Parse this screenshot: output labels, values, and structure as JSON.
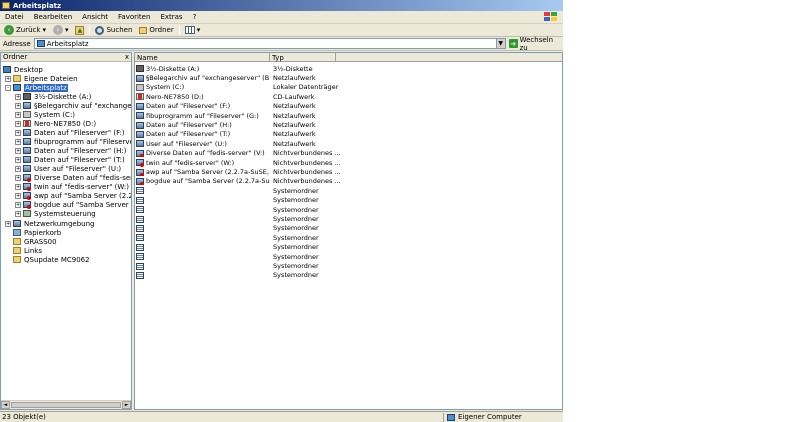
{
  "window": {
    "title": "Arbeitsplatz"
  },
  "menu": [
    "Datei",
    "Bearbeiten",
    "Ansicht",
    "Favoriten",
    "Extras",
    "?"
  ],
  "toolbar": {
    "back": "Zurück",
    "search": "Suchen",
    "folders": "Ordner"
  },
  "address": {
    "label": "Adresse",
    "value": "Arbeitsplatz",
    "go": "Wechseln zu"
  },
  "folder_pane": {
    "header": "Ordner",
    "close": "x",
    "tree": [
      {
        "label": "Desktop",
        "icon": "desktop-icon"
      },
      {
        "label": "Eigene Dateien",
        "icon": "folder-icon"
      },
      {
        "label": "Arbeitsplatz",
        "icon": "computer-icon",
        "selected": true
      },
      {
        "label": "3½-Diskette (A:)",
        "icon": "floppy-icon"
      },
      {
        "label": "§Belegarchiv auf \"exchangeserver\" (B:)",
        "icon": "network-drive-icon"
      },
      {
        "label": "System (C:)",
        "icon": "drive-icon"
      },
      {
        "label": "Nero-NE7850 (D:)",
        "icon": "cd-drive-icon"
      },
      {
        "label": "Daten auf \"Fileserver\" (F:)",
        "icon": "network-drive-icon"
      },
      {
        "label": "fibuprogramm auf \"Fileserver\" (G:)",
        "icon": "network-drive-icon"
      },
      {
        "label": "Daten auf \"Fileserver\" (H:)",
        "icon": "network-drive-icon"
      },
      {
        "label": "Daten auf \"Fileserver\" (T:)",
        "icon": "network-drive-icon"
      },
      {
        "label": "User auf \"Fileserver\" (U:)",
        "icon": "network-drive-icon"
      },
      {
        "label": "Diverse Daten auf \"fedis-server\" (V:)",
        "icon": "disconnected-drive-icon"
      },
      {
        "label": "twin auf \"fedis-server\" (W:)",
        "icon": "disconnected-drive-icon"
      },
      {
        "label": "awp auf \"Samba Server (2.2.7a-SuSE)\"",
        "icon": "disconnected-drive-icon"
      },
      {
        "label": "bogdue auf \"Samba Server (2.2.7a-SuSE)\"",
        "icon": "disconnected-drive-icon"
      },
      {
        "label": "Systemsteuerung",
        "icon": "control-panel-icon"
      },
      {
        "label": "Netzwerkumgebung",
        "icon": "network-places-icon"
      },
      {
        "label": "Papierkorb",
        "icon": "recycle-bin-icon"
      },
      {
        "label": "GRASS00",
        "icon": "folder-icon"
      },
      {
        "label": "Links",
        "icon": "folder-icon"
      },
      {
        "label": "QSupdate MC9062",
        "icon": "folder-icon"
      }
    ]
  },
  "list": {
    "columns": [
      "Name",
      "Typ"
    ],
    "rows": [
      {
        "name": "3½-Diskette (A:)",
        "type": "3½-Diskette",
        "icon": "floppy-icon"
      },
      {
        "name": "§Belegarchiv auf \"exchangeserver\" (B:)",
        "type": "Netzlaufwerk",
        "icon": "network-drive-icon"
      },
      {
        "name": "System (C:)",
        "type": "Lokaler Datenträger",
        "icon": "drive-icon"
      },
      {
        "name": "Nero-NE7850 (D:)",
        "type": "CD-Laufwerk",
        "icon": "cd-drive-icon"
      },
      {
        "name": "Daten auf \"Fileserver\" (F:)",
        "type": "Netzlaufwerk",
        "icon": "network-drive-icon"
      },
      {
        "name": "fibuprogramm auf \"Fileserver\" (G:)",
        "type": "Netzlaufwerk",
        "icon": "network-drive-icon"
      },
      {
        "name": "Daten auf \"Fileserver\" (H:)",
        "type": "Netzlaufwerk",
        "icon": "network-drive-icon"
      },
      {
        "name": "Daten auf \"Fileserver\" (T:)",
        "type": "Netzlaufwerk",
        "icon": "network-drive-icon"
      },
      {
        "name": "User auf \"Fileserver\" (U:)",
        "type": "Netzlaufwerk",
        "icon": "network-drive-icon"
      },
      {
        "name": "Diverse Daten auf \"fedis-server\" (V:)",
        "type": "Nichtverbundenes ...",
        "icon": "disconnected-drive-icon"
      },
      {
        "name": "twin auf \"fedis-server\" (W:)",
        "type": "Nichtverbundenes ...",
        "icon": "disconnected-drive-icon"
      },
      {
        "name": "awp auf \"Samba Server (2.2.7a-SuSE, gras...",
        "type": "Nichtverbundenes ...",
        "icon": "disconnected-drive-icon"
      },
      {
        "name": "bogdue auf \"Samba Server (2.2.7a-SuSE, g...",
        "type": "Nichtverbundenes ...",
        "icon": "disconnected-drive-icon"
      },
      {
        "name": "",
        "type": "Systemordner",
        "icon": "system-folder-icon"
      },
      {
        "name": "",
        "type": "Systemordner",
        "icon": "system-folder-icon"
      },
      {
        "name": "",
        "type": "Systemordner",
        "icon": "system-folder-icon"
      },
      {
        "name": "",
        "type": "Systemordner",
        "icon": "system-folder-icon"
      },
      {
        "name": "",
        "type": "Systemordner",
        "icon": "system-folder-icon"
      },
      {
        "name": "",
        "type": "Systemordner",
        "icon": "system-folder-icon"
      },
      {
        "name": "",
        "type": "Systemordner",
        "icon": "system-folder-icon"
      },
      {
        "name": "",
        "type": "Systemordner",
        "icon": "system-folder-icon"
      },
      {
        "name": "",
        "type": "Systemordner",
        "icon": "system-folder-icon"
      },
      {
        "name": "",
        "type": "Systemordner",
        "icon": "system-folder-icon"
      }
    ]
  },
  "status": {
    "count": "23 Objekt(e)",
    "zone": "Eigener Computer"
  }
}
